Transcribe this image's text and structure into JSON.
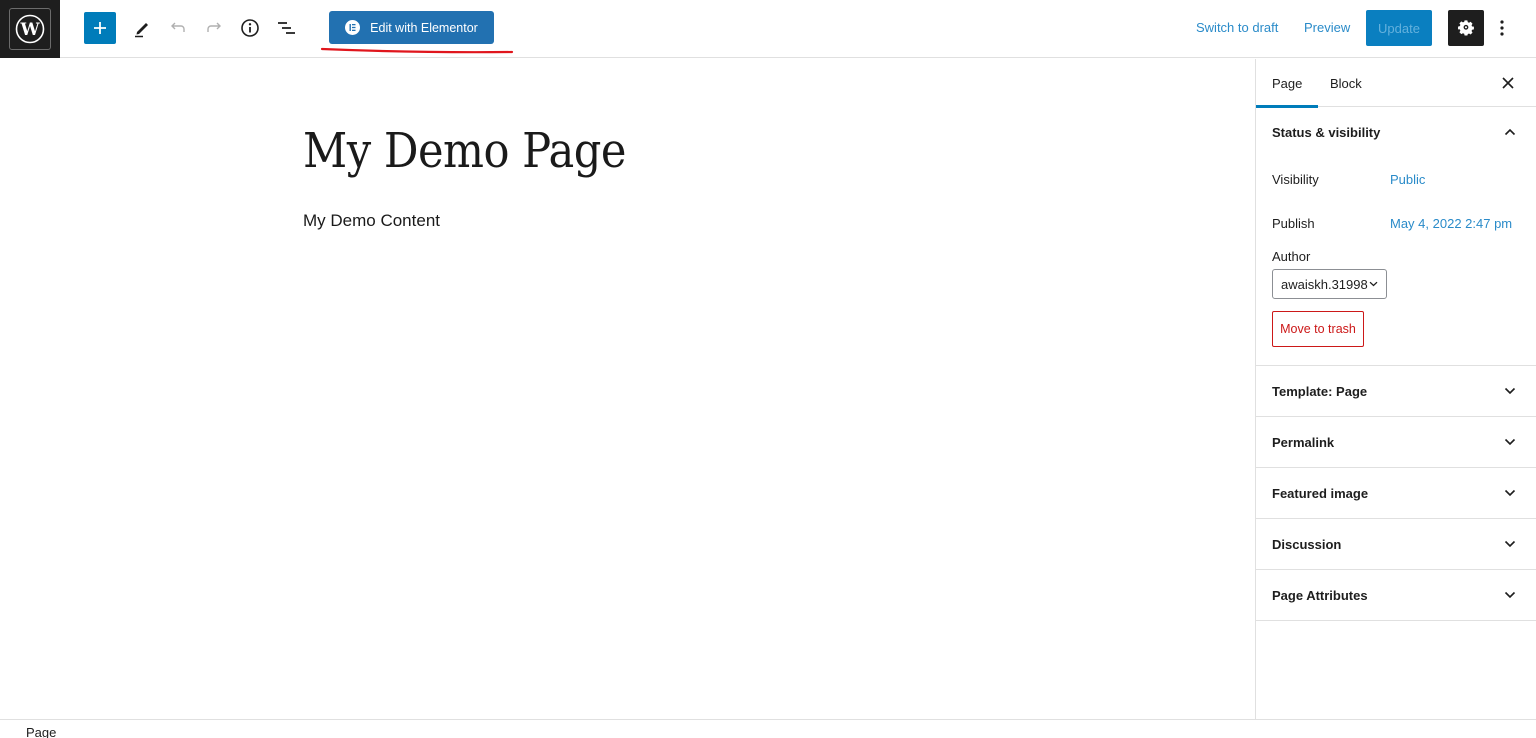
{
  "header": {
    "logo": "wordpress-logo",
    "toolbar": {
      "add_block_icon": "plus-icon",
      "tools_icon": "pencil-icon",
      "undo_icon": "undo-icon",
      "redo_icon": "redo-icon",
      "details_icon": "info-icon",
      "list_view_icon": "list-view-icon"
    },
    "elementor_button": {
      "label": "Edit with Elementor",
      "icon": "elementor-icon"
    },
    "switch_to_draft": "Switch to draft",
    "preview": "Preview",
    "update": "Update",
    "settings_icon": "gear-icon",
    "more_icon": "more-vertical-icon",
    "colors": {
      "accent": "#007cba",
      "elementor": "#2271b1",
      "annotation": "#e0161d"
    }
  },
  "editor": {
    "title": "My Demo Page",
    "content": "My Demo Content"
  },
  "sidebar": {
    "tabs": [
      {
        "label": "Page",
        "active": true
      },
      {
        "label": "Block",
        "active": false
      }
    ],
    "close_icon": "close-icon",
    "status_visibility": {
      "title": "Status & visibility",
      "expanded": true,
      "visibility_label": "Visibility",
      "visibility_value": "Public",
      "publish_label": "Publish",
      "publish_value": "May 4, 2022 2:47 pm",
      "author_label": "Author",
      "author_value": "awaiskh.31998",
      "trash_label": "Move to trash"
    },
    "panels": [
      {
        "title": "Template: Page"
      },
      {
        "title": "Permalink"
      },
      {
        "title": "Featured image"
      },
      {
        "title": "Discussion"
      },
      {
        "title": "Page Attributes"
      }
    ]
  },
  "footer": {
    "breadcrumb": "Page"
  }
}
